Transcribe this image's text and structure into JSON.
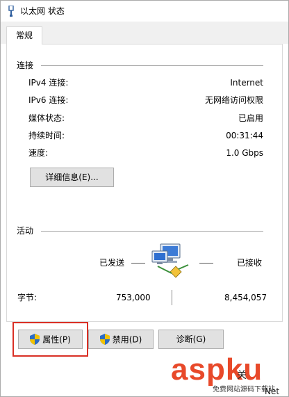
{
  "window": {
    "title": "以太网 状态"
  },
  "tabs": [
    {
      "label": "常规"
    }
  ],
  "connection": {
    "group_title": "连接",
    "rows": [
      {
        "label": "IPv4 连接:",
        "value": "Internet"
      },
      {
        "label": "IPv6 连接:",
        "value": "无网络访问权限"
      },
      {
        "label": "媒体状态:",
        "value": "已启用"
      },
      {
        "label": "持续时间:",
        "value": "00:31:44"
      },
      {
        "label": "速度:",
        "value": "1.0 Gbps"
      }
    ],
    "details_button": "详细信息(E)..."
  },
  "activity": {
    "group_title": "活动",
    "sent_label": "已发送",
    "received_label": "已接收",
    "bytes_label": "字节:",
    "bytes_sent": "753,000",
    "bytes_received": "8,454,057"
  },
  "buttons": {
    "properties": "属性(P)",
    "disable": "禁用(D)",
    "diagnose": "诊断(G)"
  },
  "watermark": {
    "brand": "aspku",
    "sub": "免费网站源码下载站",
    "peek": "关",
    "peek2": "Net"
  },
  "colors": {
    "highlight": "#d93025",
    "watermark": "#e8492a",
    "shield_blue": "#2b6cc4",
    "shield_yellow": "#f2c200"
  }
}
